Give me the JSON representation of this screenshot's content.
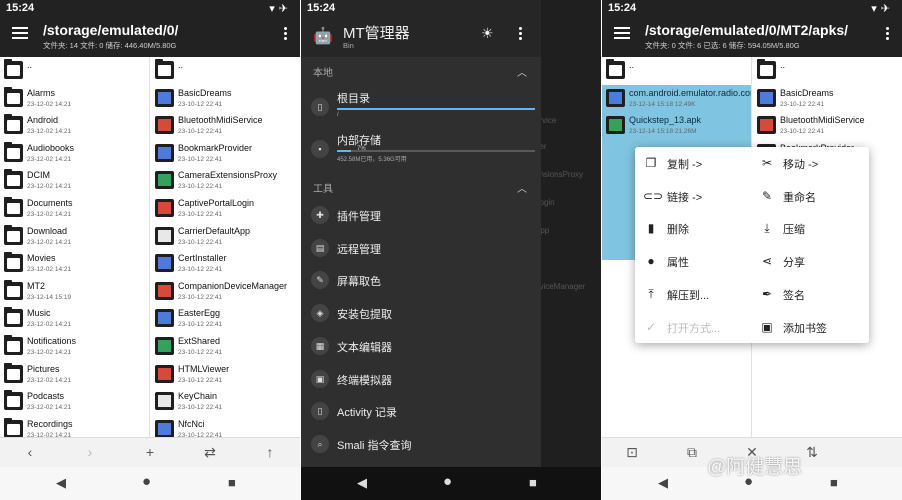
{
  "screen1": {
    "status_time": "15:24",
    "path": "/storage/emulated/0/",
    "info": "文件夹: 14  文件: 0  储存: 446.40M/5.80G",
    "left_items": [
      {
        "name": "..",
        "date": ""
      },
      {
        "name": "Alarms",
        "date": "23-12-02 14:21"
      },
      {
        "name": "Android",
        "date": "23-12-02 14:21"
      },
      {
        "name": "Audiobooks",
        "date": "23-12-02 14:21"
      },
      {
        "name": "DCIM",
        "date": "23-12-02 14:21"
      },
      {
        "name": "Documents",
        "date": "23-12-02 14:21"
      },
      {
        "name": "Download",
        "date": "23-12-02 14:21"
      },
      {
        "name": "Movies",
        "date": "23-12-02 14:21"
      },
      {
        "name": "MT2",
        "date": "23-12-14 15:19"
      },
      {
        "name": "Music",
        "date": "23-12-02 14:21"
      },
      {
        "name": "Notifications",
        "date": "23-12-02 14:21"
      },
      {
        "name": "Pictures",
        "date": "23-12-02 14:21"
      },
      {
        "name": "Podcasts",
        "date": "23-12-02 14:21"
      },
      {
        "name": "Recordings",
        "date": "23-12-02 14:21"
      }
    ],
    "right_items": [
      {
        "name": "..",
        "date": ""
      },
      {
        "name": "BasicDreams",
        "date": "23-10-12 22:41"
      },
      {
        "name": "BluetoothMidiService",
        "date": "23-10-12 22:41"
      },
      {
        "name": "BookmarkProvider",
        "date": "23-10-12 22:41"
      },
      {
        "name": "CameraExtensionsProxy",
        "date": "23-10-12 22:41"
      },
      {
        "name": "CaptivePortalLogin",
        "date": "23-10-12 22:41"
      },
      {
        "name": "CarrierDefaultApp",
        "date": "23-10-12 22:41"
      },
      {
        "name": "CertInstaller",
        "date": "23-10-12 22:41"
      },
      {
        "name": "CompanionDeviceManager",
        "date": "23-10-12 22:41"
      },
      {
        "name": "EasterEgg",
        "date": "23-10-12 22:41"
      },
      {
        "name": "ExtShared",
        "date": "23-10-12 22:41"
      },
      {
        "name": "HTMLViewer",
        "date": "23-10-12 22:41"
      },
      {
        "name": "KeyChain",
        "date": "23-10-12 22:41"
      },
      {
        "name": "NfcNci",
        "date": "23-10-12 22:41"
      }
    ]
  },
  "screen2": {
    "status_time": "15:24",
    "app_title": "MT管理器",
    "app_sub": "Bin",
    "section_local": "本地",
    "root_label": "根目录",
    "root_detail": "/",
    "internal_label": "内部存储",
    "internal_percent": "7%",
    "internal_detail": "452.58M已用，5.36G可用",
    "internal_fill": 0.07,
    "section_tools": "工具",
    "tools": [
      {
        "label": "插件管理",
        "icon": "puzzle-icon"
      },
      {
        "label": "远程管理",
        "icon": "file-icon"
      },
      {
        "label": "屏幕取色",
        "icon": "eyedropper-icon"
      },
      {
        "label": "安装包提取",
        "icon": "layers-icon"
      },
      {
        "label": "文本编辑器",
        "icon": "document-icon"
      },
      {
        "label": "终端模拟器",
        "icon": "terminal-icon"
      },
      {
        "label": "Activity 记录",
        "icon": "phone-icon"
      },
      {
        "label": "Smali 指令查询",
        "icon": "search-icon"
      }
    ],
    "ghost": [
      "ervice",
      "der",
      "ensionsProxy",
      "Login",
      "App",
      "eviceManager"
    ]
  },
  "screen3": {
    "status_time": "15:24",
    "path": "/storage/emulated/0/MT2/apks/",
    "info": "文件夹: 0  文件: 6  已选: 6  储存: 594.05M/5.80G",
    "left_items": [
      {
        "name": "..",
        "date": ""
      },
      {
        "name": "com.android.emulator.radio.config_13.apk",
        "date": "23-12-14 15:18  12.49K"
      },
      {
        "name": "Quickstep_13.apk",
        "date": "23-12-14 15:18  21.26M"
      }
    ],
    "right_items": [
      {
        "name": "..",
        "date": ""
      },
      {
        "name": "BasicDreams",
        "date": "23-10-12 22:41"
      },
      {
        "name": "BluetoothMidiService",
        "date": "23-10-12 22:41"
      },
      {
        "name": "BookmarkProvider",
        "date": ""
      },
      {
        "name": "Manager",
        "date": "22:41"
      },
      {
        "name": "HTMLViewer",
        "date": "23-10-12 22:41"
      },
      {
        "name": "KeyChain",
        "date": "23-10-12 22:41"
      },
      {
        "name": "NfcNci",
        "date": "23-10-12 22:41"
      }
    ],
    "menu": [
      {
        "label": "复制 ->",
        "icon": "copy-icon",
        "enabled": true
      },
      {
        "label": "移动 ->",
        "icon": "scissors-icon",
        "enabled": true
      },
      {
        "label": "链接 ->",
        "icon": "link-icon",
        "enabled": true
      },
      {
        "label": "重命名",
        "icon": "pencil-icon",
        "enabled": true
      },
      {
        "label": "删除",
        "icon": "trash-icon",
        "enabled": true
      },
      {
        "label": "压缩",
        "icon": "download-icon",
        "enabled": true
      },
      {
        "label": "属性",
        "icon": "info-icon",
        "enabled": true
      },
      {
        "label": "分享",
        "icon": "share-icon",
        "enabled": true
      },
      {
        "label": "解压到...",
        "icon": "upload-icon",
        "enabled": true
      },
      {
        "label": "签名",
        "icon": "signature-icon",
        "enabled": true
      },
      {
        "label": "打开方式...",
        "icon": "check-icon",
        "enabled": false
      },
      {
        "label": "添加书签",
        "icon": "bookmark-icon",
        "enabled": true
      }
    ],
    "watermark": "@阿健慧思"
  }
}
